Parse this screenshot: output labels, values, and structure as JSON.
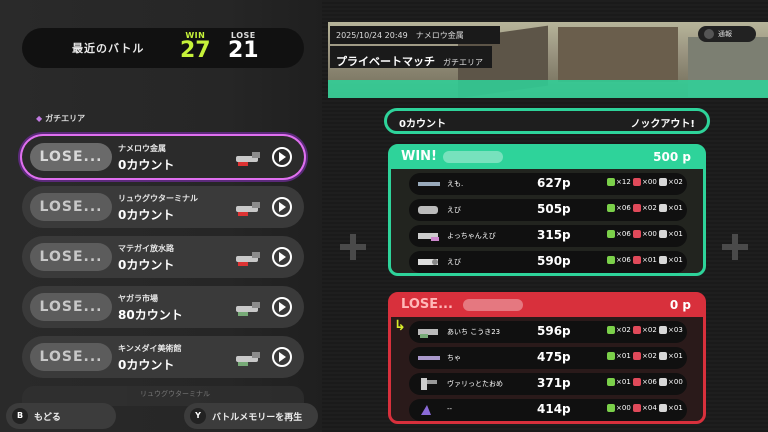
{
  "header": {
    "title": "最近のバトル",
    "win_label": "WIN",
    "win_count": "27",
    "lose_label": "LOSE",
    "lose_count": "21"
  },
  "mode_label": "ガチエリア",
  "matches": [
    {
      "result": "LOSE...",
      "stage": "ナメロウ金属",
      "count": "0カウント",
      "selected": true
    },
    {
      "result": "LOSE...",
      "stage": "リュウグウターミナル",
      "count": "0カウント"
    },
    {
      "result": "LOSE...",
      "stage": "マテガイ放水路",
      "count": "0カウント"
    },
    {
      "result": "LOSE...",
      "stage": "ヤガラ市場",
      "count": "80カウント"
    },
    {
      "result": "LOSE...",
      "stage": "キンメダイ美術館",
      "count": "0カウント"
    }
  ],
  "partial_match_stage": "リュウグウターミナル",
  "buttons": {
    "back_key": "B",
    "back_label": "もどる",
    "replay_key": "Y",
    "replay_label": "バトルメモリーを再生"
  },
  "detail": {
    "datetime": "2025/10/24 20:49",
    "stage": "ナメロウ金属",
    "match_type": "プライベートマッチ",
    "mode": "ガチエリア",
    "notify_label": "通報",
    "score_left": "0カウント",
    "score_right": "ノックアウト!"
  },
  "teams": {
    "win": {
      "result": "WIN!",
      "points": "500 p",
      "players": [
        {
          "name": "えも.",
          "points": "627p",
          "kills": "×12",
          "deaths": "×00",
          "specials": "×02"
        },
        {
          "name": "えび",
          "points": "505p",
          "kills": "×06",
          "deaths": "×02",
          "specials": "×01"
        },
        {
          "name": "よっちゃんえび",
          "points": "315p",
          "kills": "×06",
          "deaths": "×00",
          "specials": "×01"
        },
        {
          "name": "えび",
          "points": "590p",
          "kills": "×06",
          "deaths": "×01",
          "specials": "×01"
        }
      ]
    },
    "lose": {
      "result": "LOSE...",
      "points": "0 p",
      "players": [
        {
          "name": "あいち こうき23",
          "points": "596p",
          "kills": "×02",
          "deaths": "×02",
          "specials": "×03"
        },
        {
          "name": "ちゃ",
          "points": "475p",
          "kills": "×01",
          "deaths": "×02",
          "specials": "×01"
        },
        {
          "name": "ヴァリっとたおめ",
          "points": "371p",
          "kills": "×01",
          "deaths": "×06",
          "specials": "×00"
        },
        {
          "name": "--",
          "points": "414p",
          "kills": "×00",
          "deaths": "×04",
          "specials": "×01"
        }
      ]
    }
  },
  "colors": {
    "win_accent": "#c6f23a",
    "team_win": "#2ed39a",
    "team_lose": "#d8303c",
    "selected_glow": "#e070f0"
  }
}
